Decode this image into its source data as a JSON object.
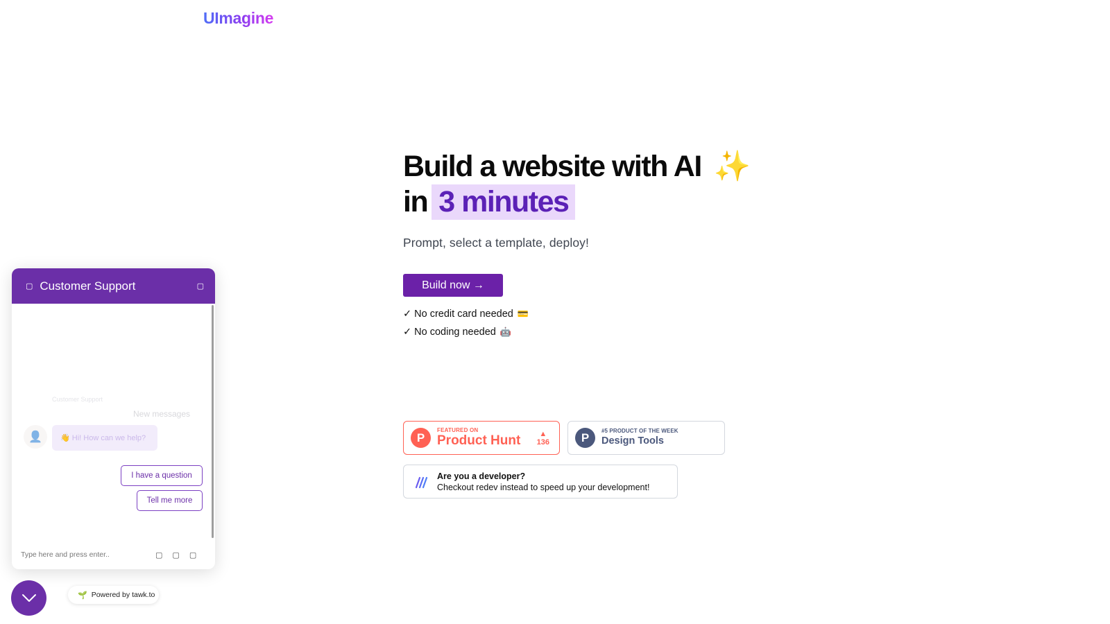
{
  "brand": {
    "logo": "UImagine"
  },
  "hero": {
    "title_line1": "Build a website with AI",
    "sparkle": "✨",
    "title_in": "in",
    "title_highlight": "3 minutes",
    "subtitle": "Prompt, select a template, deploy!",
    "cta_label": "Build now →",
    "checks": [
      {
        "mark": "✓",
        "text": "No credit card needed",
        "emoji": "💳"
      },
      {
        "mark": "✓",
        "text": "No coding needed",
        "emoji": "🤖"
      }
    ]
  },
  "badges": {
    "product_hunt": {
      "letter": "P",
      "small": "FEATURED ON",
      "big": "Product Hunt",
      "votes": "136",
      "arrow": "▲"
    },
    "design_tools": {
      "letter": "P",
      "small": "#5 PRODUCT OF THE WEEK",
      "big": "Design Tools"
    },
    "developer": {
      "title": "Are you a developer?",
      "subtitle": "Checkout redev instead to speed up your development!"
    }
  },
  "chat": {
    "title": "Customer Support",
    "agent_label": "Customer Support",
    "new_messages": "New messages",
    "greeting": "👋 Hi! How can we help?",
    "quick_replies": [
      "I have a question",
      "Tell me more"
    ],
    "input_placeholder": "Type here and press enter..",
    "powered_by": "Powered by tawk.to"
  },
  "colors": {
    "accent": "#6b2fa8",
    "product_hunt": "#ff6154",
    "highlight_bg": "#ead8fb"
  }
}
